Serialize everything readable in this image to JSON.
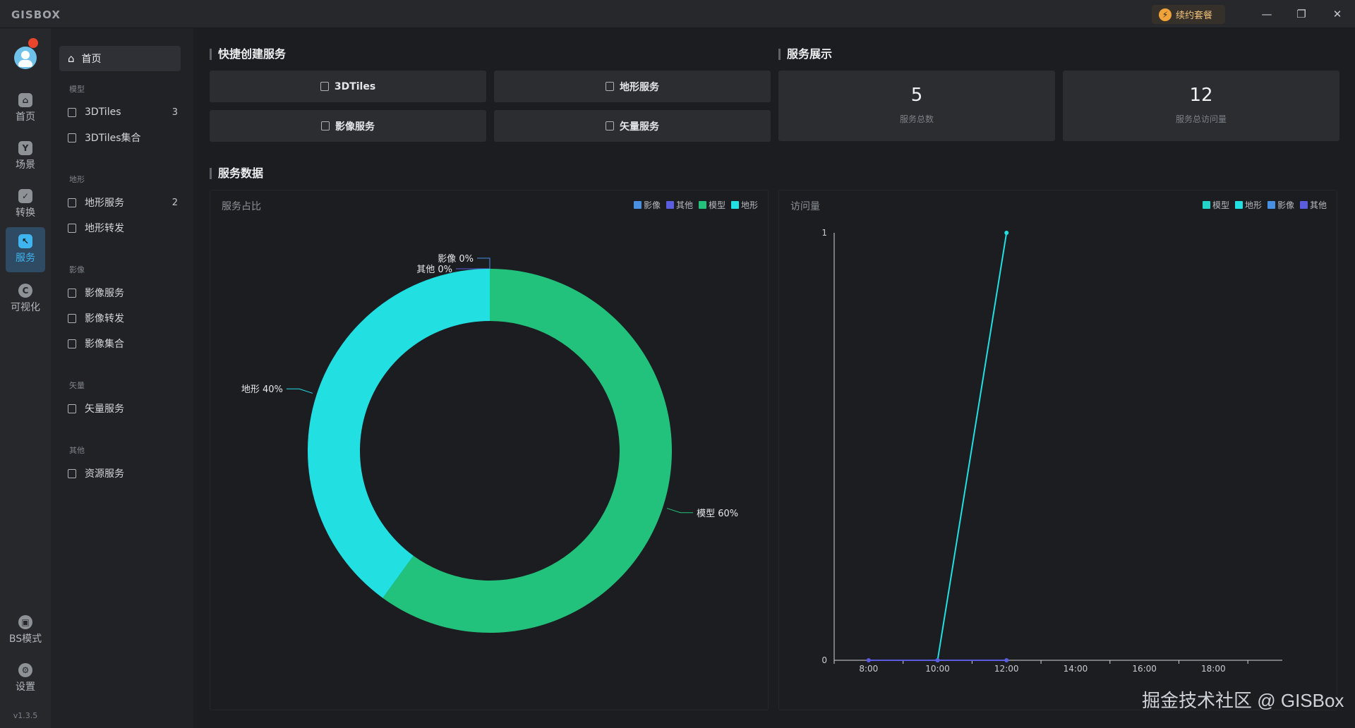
{
  "app": {
    "logo": "GISBOX",
    "renew_label": "续约套餐",
    "version": "v1.3.5",
    "window_controls": [
      "—",
      "❐",
      "✕"
    ]
  },
  "nav": [
    {
      "label": "首页",
      "icon": "home-icon"
    },
    {
      "label": "场景",
      "icon": "scene-icon"
    },
    {
      "label": "转换",
      "icon": "convert-icon"
    },
    {
      "label": "服务",
      "icon": "service-icon",
      "active": true
    },
    {
      "label": "可视化",
      "icon": "visualize-icon"
    }
  ],
  "nav_bottom": [
    {
      "label": "BS模式",
      "icon": "lock-icon"
    },
    {
      "label": "设置",
      "icon": "gear-icon"
    }
  ],
  "sidebar": {
    "home": "首页",
    "groups": [
      {
        "title": "模型",
        "items": [
          {
            "label": "3DTiles",
            "count": "3"
          },
          {
            "label": "3DTiles集合",
            "count": ""
          }
        ]
      },
      {
        "title": "地形",
        "items": [
          {
            "label": "地形服务",
            "count": "2"
          },
          {
            "label": "地形转发",
            "count": ""
          }
        ]
      },
      {
        "title": "影像",
        "items": [
          {
            "label": "影像服务",
            "count": ""
          },
          {
            "label": "影像转发",
            "count": ""
          },
          {
            "label": "影像集合",
            "count": ""
          }
        ]
      },
      {
        "title": "矢量",
        "items": [
          {
            "label": "矢量服务",
            "count": ""
          }
        ]
      },
      {
        "title": "其他",
        "items": [
          {
            "label": "资源服务",
            "count": ""
          }
        ]
      }
    ]
  },
  "quick_create": {
    "title": "快捷创建服务",
    "buttons": [
      "3DTiles",
      "地形服务",
      "影像服务",
      "矢量服务"
    ]
  },
  "service_display": {
    "title": "服务展示",
    "cards": [
      {
        "value": "5",
        "label": "服务总数"
      },
      {
        "value": "12",
        "label": "服务总访问量"
      }
    ]
  },
  "service_data": {
    "title": "服务数据"
  },
  "colors": {
    "image": "#4a90e2",
    "other": "#5c5ce0",
    "model": "#23c27c",
    "terrain": "#22dfe2"
  },
  "chart_data": [
    {
      "type": "pie",
      "title": "服务占比",
      "legend": [
        "影像",
        "其他",
        "模型",
        "地形"
      ],
      "legend_position": "top-right",
      "slices": [
        {
          "name": "影像",
          "value": 0,
          "label": "影像 0%"
        },
        {
          "name": "其他",
          "value": 0,
          "label": "其他 0%"
        },
        {
          "name": "模型",
          "value": 60,
          "label": "模型 60%"
        },
        {
          "name": "地形",
          "value": 40,
          "label": "地形 40%"
        }
      ]
    },
    {
      "type": "line",
      "title": "访问量",
      "legend": [
        "模型",
        "地形",
        "影像",
        "其他"
      ],
      "legend_position": "top-right",
      "x": [
        "8:00",
        "10:00",
        "12:00",
        "14:00",
        "16:00",
        "18:00"
      ],
      "ylim": [
        0,
        1
      ],
      "yticks": [
        "0",
        "1"
      ],
      "series": [
        {
          "name": "地形",
          "x": [
            "10:00",
            "12:00"
          ],
          "values": [
            0,
            1
          ]
        },
        {
          "name": "其他",
          "x": [
            "8:00",
            "10:00",
            "12:00"
          ],
          "values": [
            0,
            0,
            0
          ]
        }
      ]
    }
  ],
  "watermark": "掘金技术社区 @ GISBox"
}
